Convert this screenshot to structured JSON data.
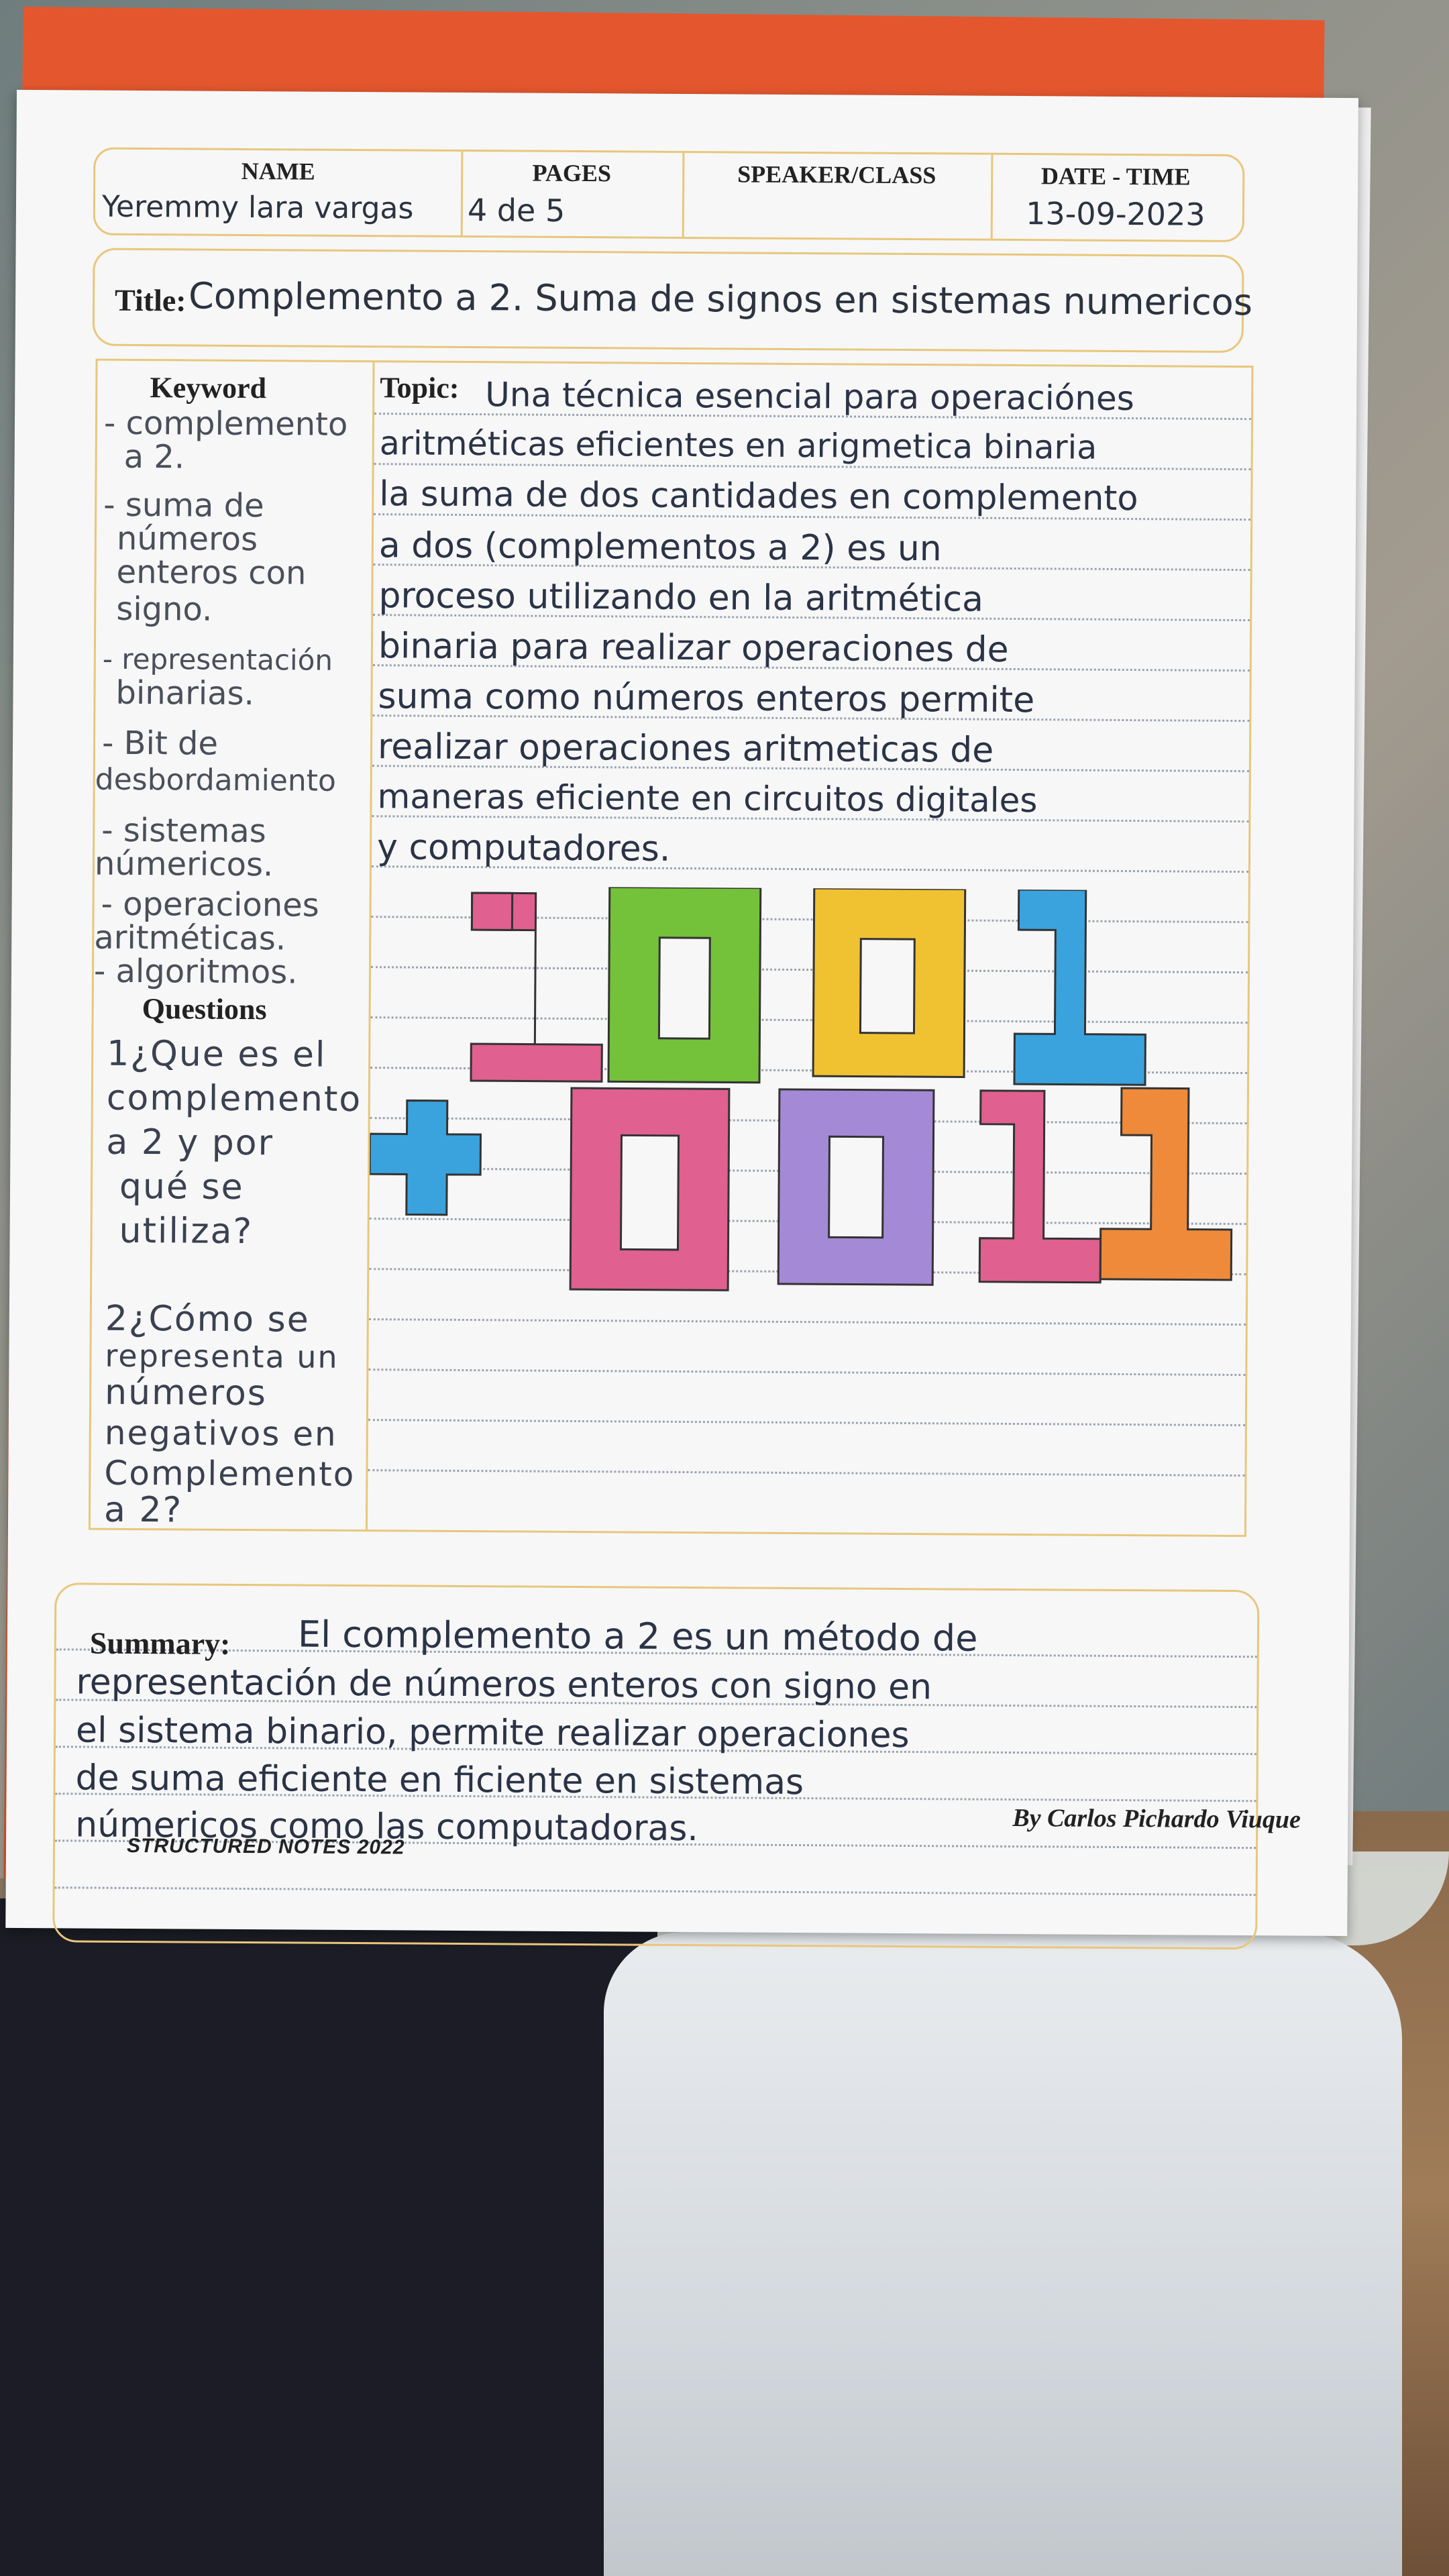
{
  "header": {
    "name_label": "NAME",
    "name_value": "Yeremmy lara vargas",
    "pages_label": "PAGES",
    "pages_value": "4 de 5",
    "speaker_label": "SPEAKER/CLASS",
    "speaker_value": "",
    "date_label": "DATE - TIME",
    "date_value": "13-09-2023"
  },
  "title": {
    "label": "Title:",
    "value": "Complemento a 2. Suma de signos en sistemas numericos"
  },
  "keyword": {
    "heading": "Keyword",
    "items": [
      "- complemento",
      "  a 2.",
      "- suma de",
      "  números",
      "  enteros con",
      "  signo.",
      "- representación",
      "  binarias.",
      "- Bit de",
      "desbordamiento",
      "- sistemas",
      "númericos.",
      "- operaciones",
      "aritméticas.",
      "- algoritmos."
    ]
  },
  "questions": {
    "heading": "Questions",
    "items": [
      "1¿Que es el",
      "complemento",
      "a 2 y por",
      "qué se",
      "utiliza?",
      "",
      "2¿Cómo se",
      "representa un",
      "números",
      "negativos en",
      "Complemento",
      "a 2?"
    ]
  },
  "topic": {
    "label": "Topic:",
    "lines": [
      "Una técnica esencial para operaciónes",
      "aritméticas eficientes en arigmetica binaria",
      "la suma de dos cantidades en complemento",
      "a dos (complementos a 2) es un",
      "proceso utilizando en la aritmética",
      "binaria para realizar operaciones de",
      "suma como números enteros permite",
      "realizar operaciones aritmeticas de",
      "maneras eficiente en circuitos digitales",
      "y computadores."
    ]
  },
  "operation": {
    "top_digits": [
      "1",
      "0",
      "0",
      "1"
    ],
    "operator": "+",
    "bottom_digits": [
      "0",
      "0",
      "1",
      "1"
    ],
    "colors": {
      "pink": "#e0608f",
      "green": "#74c13a",
      "yellow": "#f0c232",
      "blue": "#3aa3dd",
      "purple": "#a48ad6",
      "orange": "#ef8a3a"
    }
  },
  "summary": {
    "label": "Summary:",
    "lines": [
      "El complemento a 2 es un método de",
      "representación de números enteros con signo en",
      "el sistema binario, permite realizar operaciones",
      "de suma eficiente en ficiente en sistemas",
      "númericos como las computadoras."
    ]
  },
  "footer": {
    "brand": "STRUCTURED NOTES 2022",
    "signature": "By Carlos Pichardo Viuque"
  }
}
